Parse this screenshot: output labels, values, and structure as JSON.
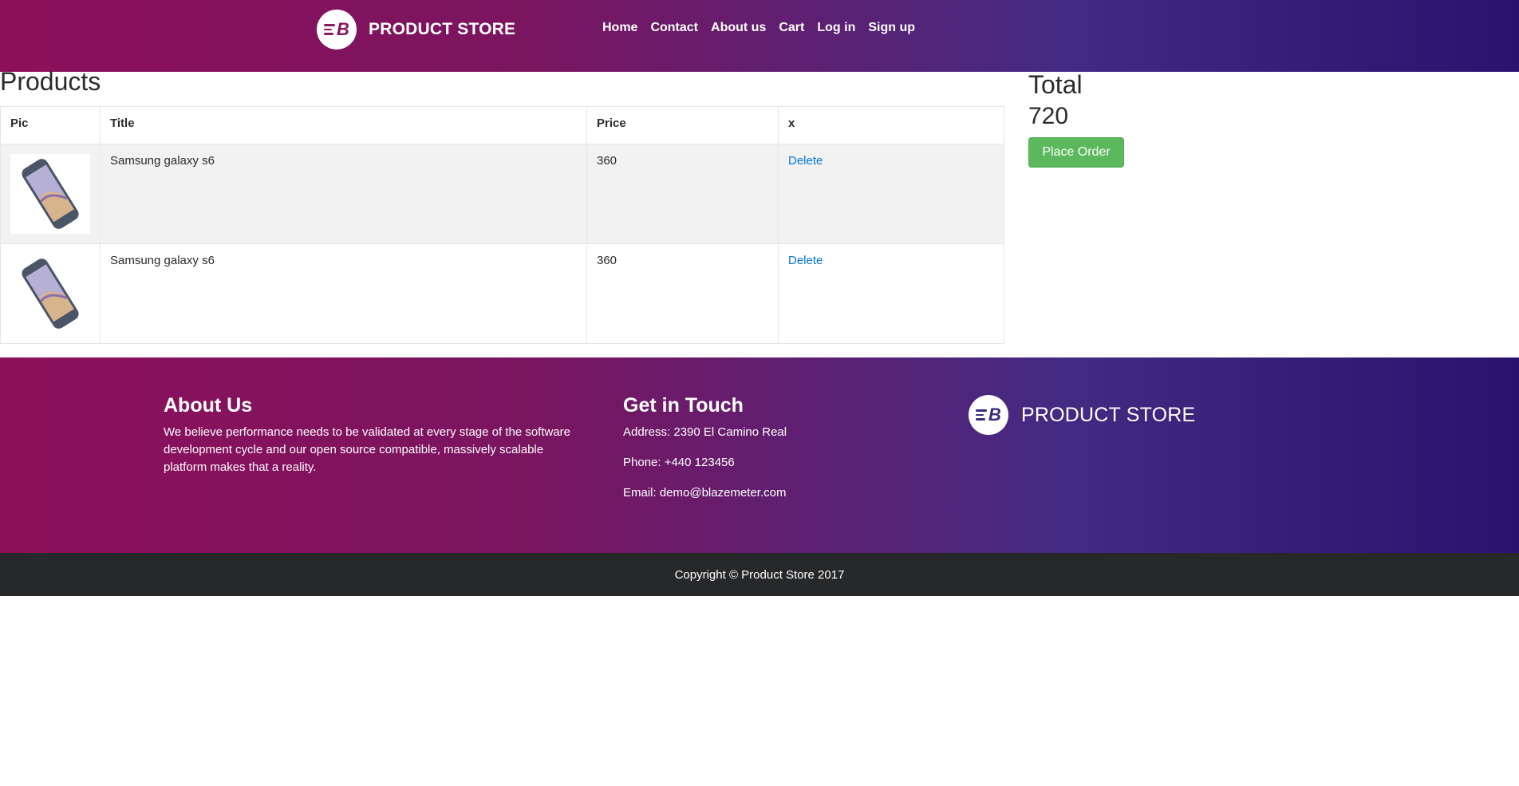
{
  "header": {
    "brand": "PRODUCT STORE",
    "logo_letter": "B",
    "nav": [
      "Home",
      "Contact",
      "About us",
      "Cart",
      "Log in",
      "Sign up"
    ]
  },
  "products": {
    "title": "Products",
    "columns": [
      "Pic",
      "Title",
      "Price",
      "x"
    ],
    "rows": [
      {
        "title": "Samsung galaxy s6",
        "price": "360",
        "action": "Delete",
        "image": "phone-image"
      },
      {
        "title": "Samsung galaxy s6",
        "price": "360",
        "action": "Delete",
        "image": "phone-image"
      }
    ]
  },
  "totals": {
    "label": "Total",
    "value": "720",
    "place_order": "Place Order"
  },
  "footer": {
    "about_title": "About Us",
    "about_text": "We believe performance needs to be validated at every stage of the software development cycle and our open source compatible, massively scalable platform makes that a reality.",
    "touch_title": "Get in Touch",
    "address": "Address: 2390 El Camino Real",
    "phone": "Phone: +440 123456",
    "email": "Email: demo@blazemeter.com",
    "brand": "PRODUCT STORE",
    "copyright": "Copyright © Product Store 2017"
  },
  "colors": {
    "gradient_start": "#8d0f5a",
    "gradient_end": "#2a126e",
    "link": "#0275d8",
    "order_button": "#5cb85c",
    "copyright_bg": "#27282a"
  }
}
